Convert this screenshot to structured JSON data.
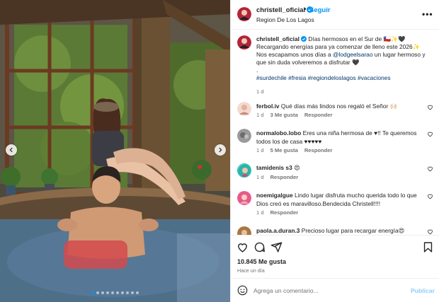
{
  "post": {
    "username": "christell_oficial",
    "follow_label": "Seguir",
    "separator": "•",
    "location": "Region De Los Lagos",
    "more_label": "•••"
  },
  "caption": {
    "username": "christell_oficial",
    "line1": "Días hermosos en el Sur de 🇨🇱✨🖤",
    "line2": "Recargando energías para ya comenzar de lleno este 2026✨",
    "line3_prefix": "Nos escapamos unos días a ",
    "mention": "@lodgeelsarao",
    "line3_suffix": " un lugar hermoso y que sin duda volveremos a disfrutar 🖤",
    "dot": ".",
    "hashtags": [
      "#surdechile",
      "#fresia",
      "#regiondeloslagos",
      "#vacaciones"
    ],
    "time": "1 d"
  },
  "comments": [
    {
      "username": "ferbol.iv",
      "text": "Qué días más lindos nos regaló el Señor 🙌🏻",
      "time": "1 d",
      "likes": "3 Me gusta",
      "reply": "Responder"
    },
    {
      "username": "normalobo.lobo",
      "text": "Eres una niña hermosa de ♥!! Te queremos todos los de casa ♥♥♥♥♥",
      "time": "1 d",
      "likes": "5 Me gusta",
      "reply": "Responder"
    },
    {
      "username": "tamidenis s3",
      "text": "😍",
      "time": "1 d",
      "reply": "Responder"
    },
    {
      "username": "noemigalgue",
      "text": "Lindo lugar disfruta mucho querida todo lo que Dios creó es maravilloso.Bendecida Christell!!!!",
      "time": "1 d",
      "reply": "Responder"
    },
    {
      "username": "paola.a.duran.3",
      "text": "Precioso lugar para recargar energía😍"
    }
  ],
  "stats": {
    "likes": "10.845 Me gusta",
    "time_ago": "Hace un día"
  },
  "add_comment": {
    "placeholder": "Agrega un comentario...",
    "submit": "Publicar"
  },
  "carousel": {
    "slide_count": 10,
    "active_index": 0
  },
  "icons": [
    "verified-icon",
    "more-icon",
    "heart-icon",
    "comment-icon",
    "share-icon",
    "bookmark-icon",
    "emoji-icon",
    "chevron-left-icon",
    "chevron-right-icon"
  ],
  "colors": {
    "link": "#00376b",
    "follow": "#0095f6",
    "verified": "#0095f6",
    "publish": "#8ecdf7",
    "muted": "#737373"
  }
}
